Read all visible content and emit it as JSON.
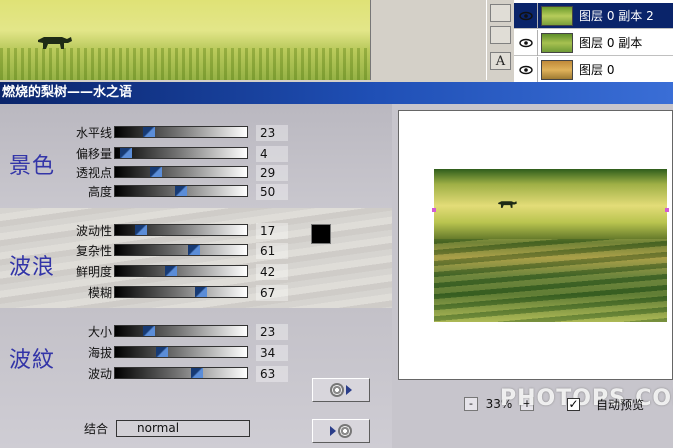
{
  "layers_panel": {
    "layers": [
      {
        "name": "图层 0 副本 2",
        "selected": true
      },
      {
        "name": "图层 0 副本",
        "selected": false
      },
      {
        "name": "图层 0",
        "selected": false
      }
    ]
  },
  "tools": {
    "text_tool_glyph": "A"
  },
  "dialog": {
    "title": "燃烧的梨树——水之语",
    "groups": [
      {
        "label": "景色",
        "sliders": [
          {
            "label": "水平线",
            "value": 23
          },
          {
            "label": "偏移量",
            "value": 4
          },
          {
            "label": "透视点",
            "value": 29
          },
          {
            "label": "高度",
            "value": 50
          }
        ]
      },
      {
        "label": "波浪",
        "sliders": [
          {
            "label": "波动性",
            "value": 17
          },
          {
            "label": "复杂性",
            "value": 61
          },
          {
            "label": "鲜明度",
            "value": 42
          },
          {
            "label": "模糊",
            "value": 67
          }
        ]
      },
      {
        "label": "波紋",
        "sliders": [
          {
            "label": "大小",
            "value": 23
          },
          {
            "label": "海拔",
            "value": 34
          },
          {
            "label": "波动",
            "value": 63
          }
        ]
      }
    ],
    "color_swatch": "#000000",
    "blend": {
      "label": "结合",
      "value": "normal"
    },
    "zoom": {
      "minus": "-",
      "value": "33%",
      "plus": "+"
    },
    "auto_preview": {
      "label": "自动预览",
      "checked": true,
      "check_glyph": "✓"
    },
    "watermark": "PHOTOPS.COM"
  },
  "colors": {
    "title_bar": "#0a246a",
    "group_label": "#3335a8",
    "slider_thumb": "#173a74",
    "selected_layer": "#0a246a"
  }
}
